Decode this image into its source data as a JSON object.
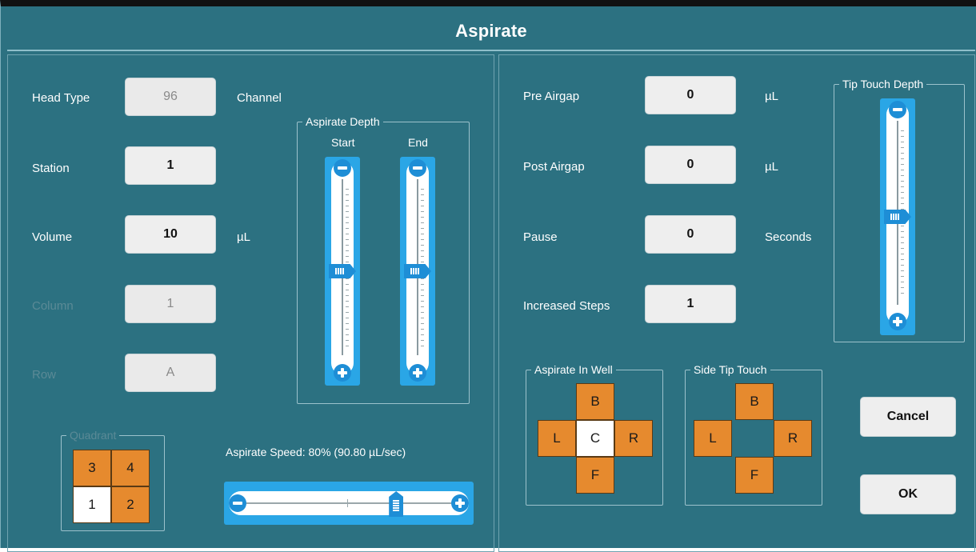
{
  "title": "Aspirate",
  "left": {
    "head_type": {
      "label": "Head Type",
      "value": "96",
      "unit": "Channel"
    },
    "station": {
      "label": "Station",
      "value": "1"
    },
    "volume": {
      "label": "Volume",
      "value": "10",
      "unit": "µL"
    },
    "column": {
      "label": "Column",
      "value": "1"
    },
    "row": {
      "label": "Row",
      "value": "A"
    },
    "aspirate_depth": {
      "title": "Aspirate Depth",
      "start_label": "Start",
      "end_label": "End",
      "start_level": 0.5,
      "end_level": 0.5
    },
    "quadrant": {
      "title": "Quadrant",
      "cells": [
        "3",
        "4",
        "1",
        "2"
      ],
      "selected": "1"
    },
    "aspirate_speed": {
      "label": "Aspirate Speed: 80% (90.80 µL/sec)",
      "percent": 80
    }
  },
  "right": {
    "pre_airgap": {
      "label": "Pre Airgap",
      "value": "0",
      "unit": "µL"
    },
    "post_airgap": {
      "label": "Post Airgap",
      "value": "0",
      "unit": "µL"
    },
    "pause": {
      "label": "Pause",
      "value": "0",
      "unit": "Seconds"
    },
    "increased_steps": {
      "label": "Increased Steps",
      "value": "1"
    },
    "tip_touch_depth": {
      "title": "Tip Touch Depth",
      "level": 0.5
    },
    "aspirate_in_well": {
      "title": "Aspirate In Well",
      "top": "B",
      "left": "L",
      "center": "C",
      "right": "R",
      "bottom": "F"
    },
    "side_tip_touch": {
      "title": "Side Tip Touch",
      "top": "B",
      "left": "L",
      "right": "R",
      "bottom": "F"
    },
    "cancel_label": "Cancel",
    "ok_label": "OK"
  },
  "colors": {
    "background": "#2c7181",
    "selected_cell": "#e68a2e",
    "slider": "#2aa6e6",
    "slider_knob": "#1e8ed6"
  },
  "icons": [
    "minus-icon",
    "plus-icon",
    "slider-thumb-icon"
  ]
}
